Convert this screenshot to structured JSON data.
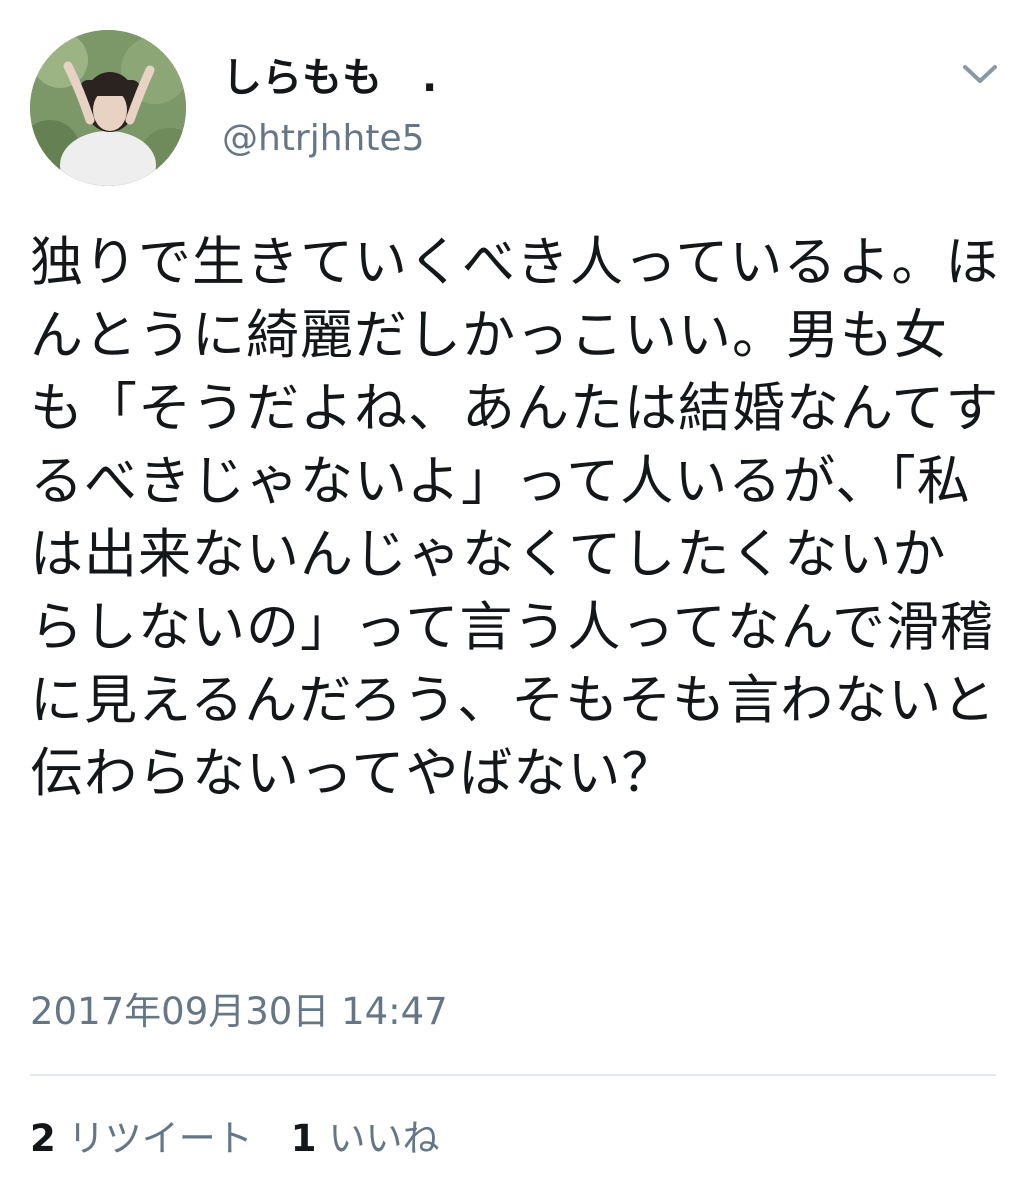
{
  "user": {
    "display_name": "しらもも　.",
    "screen_name": "@htrjhhte5",
    "avatar_icon": "profile-photo"
  },
  "menu": {
    "caret_icon": "chevron-down-icon"
  },
  "tweet": {
    "text": "独りで生きていくべき人っているよ。ほんとうに綺麗だしかっこいい。男も女も「そうだよね、あんたは結婚なんてするべきじゃないよ」って人いるが、「私は出来ないんじゃなくてしたくないからしないの」って言う人ってなんで滑稽に見えるんだろう、そもそも言わないと伝わらないってやばない？",
    "timestamp": "2017年09月30日 14:47"
  },
  "stats": {
    "retweet_count": "2",
    "retweet_label": "リツイート",
    "like_count": "1",
    "like_label": "いいね"
  },
  "colors": {
    "primary_text": "#14171a",
    "secondary_text": "#657786",
    "divider": "#e1e8ed"
  }
}
